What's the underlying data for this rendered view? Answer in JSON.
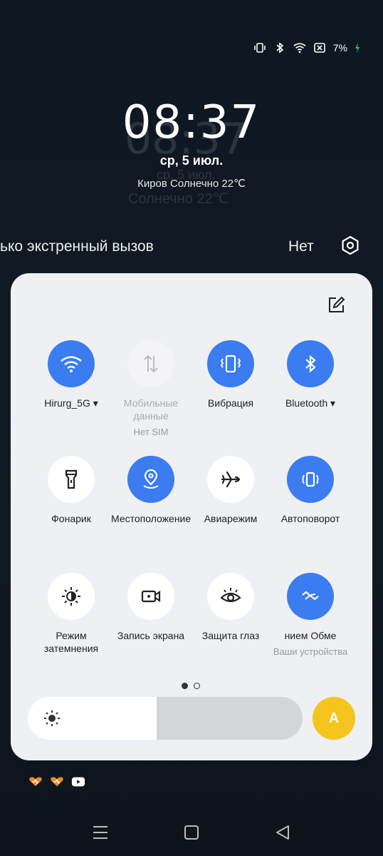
{
  "status": {
    "battery": "7%",
    "icons": [
      "vibrate-icon",
      "bluetooth-icon",
      "wifi-icon",
      "battery-icon",
      "charging-icon"
    ]
  },
  "lockscreen": {
    "time": "08:37",
    "time_ghost": "08:37",
    "date": "ср, 5 июл.",
    "date_ghost": "ср, 5 июл.",
    "weather": "Киров Солнечно 22℃",
    "weather_ghost": "Солнечно 22℃",
    "emergency_text": "ько экстренный вызов",
    "operator": "Нет"
  },
  "tiles": [
    {
      "label": "Hirurg_5G ▾",
      "sub": "",
      "state": "on",
      "icon": "wifi-icon"
    },
    {
      "label": "Мобильные данные",
      "sub": "Нет SIM",
      "state": "dis",
      "icon": "mobile-data-icon"
    },
    {
      "label": "Вибрация",
      "sub": "",
      "state": "on",
      "icon": "vibration-icon"
    },
    {
      "label": "Bluetooth ▾",
      "sub": "",
      "state": "on",
      "icon": "bluetooth-icon"
    },
    {
      "label": "Фонарик",
      "sub": "",
      "state": "off",
      "icon": "flashlight-icon"
    },
    {
      "label": "Местоположение",
      "sub": "",
      "state": "on",
      "icon": "location-icon"
    },
    {
      "label": "Авиарежим",
      "sub": "",
      "state": "off",
      "icon": "airplane-icon"
    },
    {
      "label": "Автоповорот",
      "sub": "",
      "state": "on",
      "icon": "auto-rotate-icon"
    },
    {
      "label": "Режим затемнения",
      "sub": "",
      "state": "off",
      "icon": "dark-mode-icon"
    },
    {
      "label": "Запись экрана",
      "sub": "",
      "state": "off",
      "icon": "screen-record-icon"
    },
    {
      "label": "Защита глаз",
      "sub": "",
      "state": "off",
      "icon": "eye-protection-icon"
    },
    {
      "label": "нием     Обме",
      "sub": "Ваши устройства",
      "state": "on",
      "icon": "share-icon"
    }
  ],
  "pager": {
    "pages": 2,
    "active": 0
  },
  "brightness": {
    "level": 0.47
  },
  "auto_brightness_label": "A",
  "colors": {
    "accent": "#3b7cf0",
    "panel": "#eef0f4",
    "auto": "#f5c51d"
  }
}
